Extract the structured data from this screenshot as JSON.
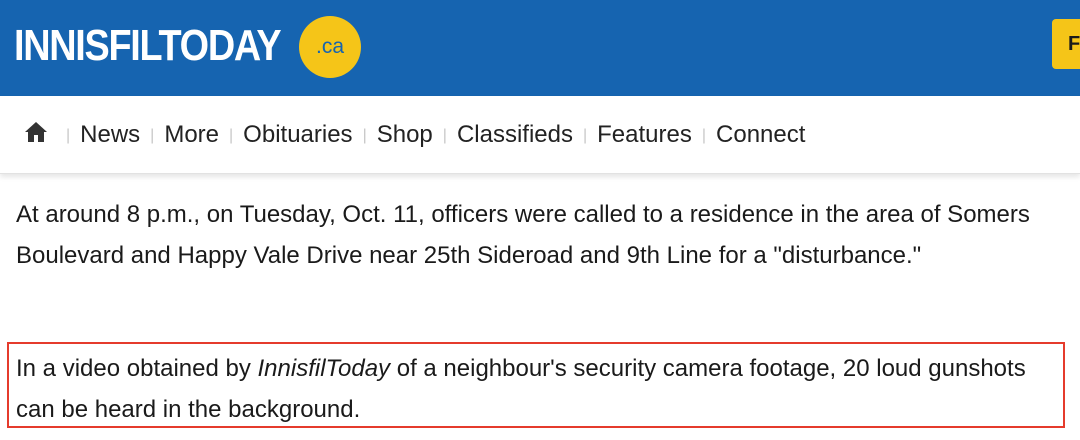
{
  "header": {
    "logo_text": "INNISFILTODAY",
    "logo_badge": ".ca",
    "partial_button": "F",
    "bg_color": "#1664b0",
    "accent_color": "#f5c518"
  },
  "nav": {
    "home_icon": "home-icon",
    "items": [
      "News",
      "More",
      "Obituaries",
      "Shop",
      "Classifieds",
      "Features",
      "Connect"
    ]
  },
  "article": {
    "paragraph1": "At around 8 p.m., on Tuesday, Oct. 11, officers were called to a residence in the area of Somers Boulevard and Happy Vale Drive near 25th Sideroad and 9th Line for a \"disturbance.\"",
    "paragraph2_before": "In a video obtained by ",
    "paragraph2_italic": "InnisfilToday",
    "paragraph2_after": " of a neighbour's security camera footage, 20 loud gunshots can be heard in the background.",
    "highlight_color": "#e53b2c"
  }
}
